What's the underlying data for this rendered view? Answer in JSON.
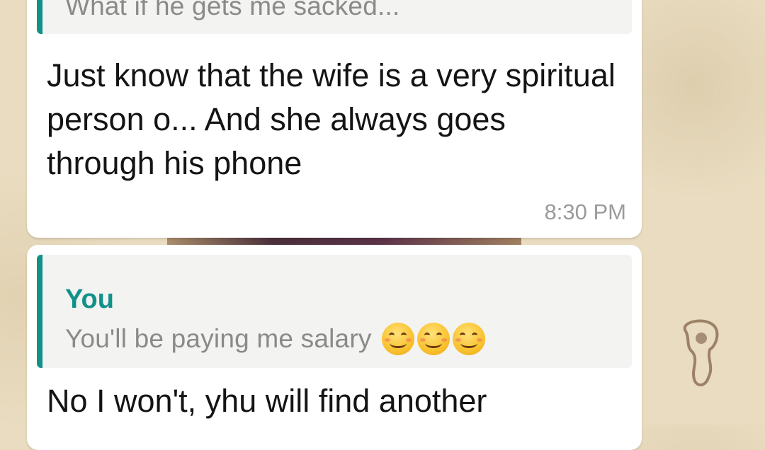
{
  "messages": [
    {
      "quoted_text": "What if he gets me sacked...",
      "text": "Just know that the wife is a very spiritual person o... And she always goes through his phone",
      "time": "8:30 PM"
    },
    {
      "quoted_author": "You",
      "quoted_text": "You'll be paying me salary",
      "quoted_emojis": [
        "smiling-face-with-smiling-eyes",
        "smiling-face-with-smiling-eyes",
        "smiling-face-with-smiling-eyes"
      ],
      "text": "No I won't, yhu will find another"
    }
  ],
  "colors": {
    "background": "#e9dcc0",
    "bubble": "#ffffff",
    "quote_accent": "#11918a",
    "quote_background": "#f3f3f2",
    "message_text": "#141414",
    "quote_text": "#8a8a8a",
    "time_text": "#9b9b9b"
  }
}
